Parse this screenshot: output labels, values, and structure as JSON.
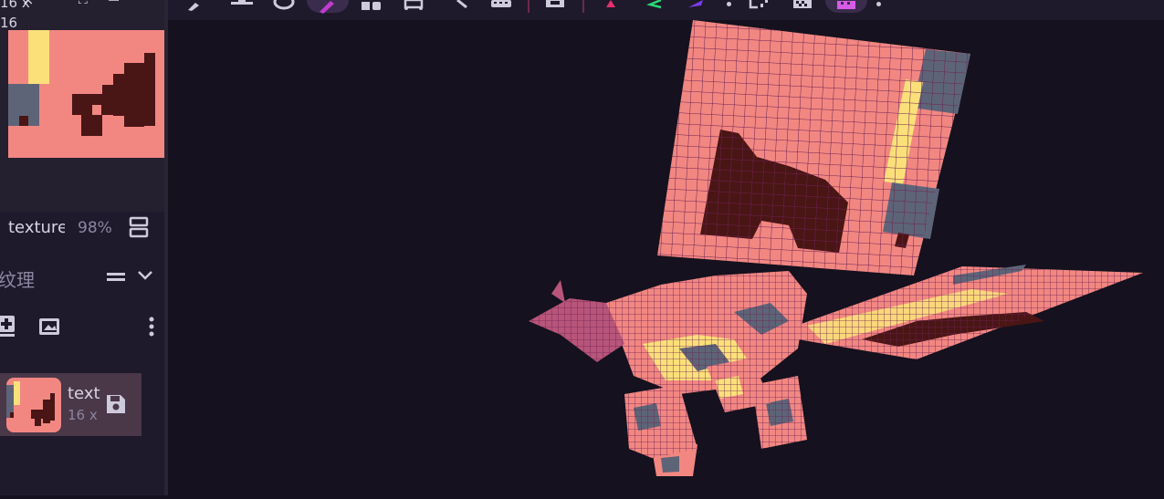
{
  "texture_preview": {
    "size_label": "16 x 16",
    "size_line_1": "16 x",
    "size_line_2": "16"
  },
  "panel": {
    "texture_name": "texture",
    "zoom": "98%",
    "section_title": "纹理"
  },
  "texture_list": [
    {
      "name": "text",
      "size": "16 x"
    }
  ],
  "toolbar": {
    "icons": [
      "brush-icon",
      "fill-line-icon",
      "eraser-icon",
      "pencil-icon",
      "shapes-icon",
      "vertex-icon",
      "magnifier-icon",
      "keyboard-icon",
      "image-icon",
      "mirror-x-icon",
      "mirror-y-icon",
      "mirror-z-icon",
      "more-icon",
      "selection-icon",
      "grid-icon",
      "checkered-icon",
      "more-2-icon"
    ]
  },
  "colors": {
    "pink": "#f28782",
    "yellow": "#fbe07a",
    "slate": "#5d6478",
    "dark": "#4a1515",
    "accent": "#c03ccf"
  }
}
